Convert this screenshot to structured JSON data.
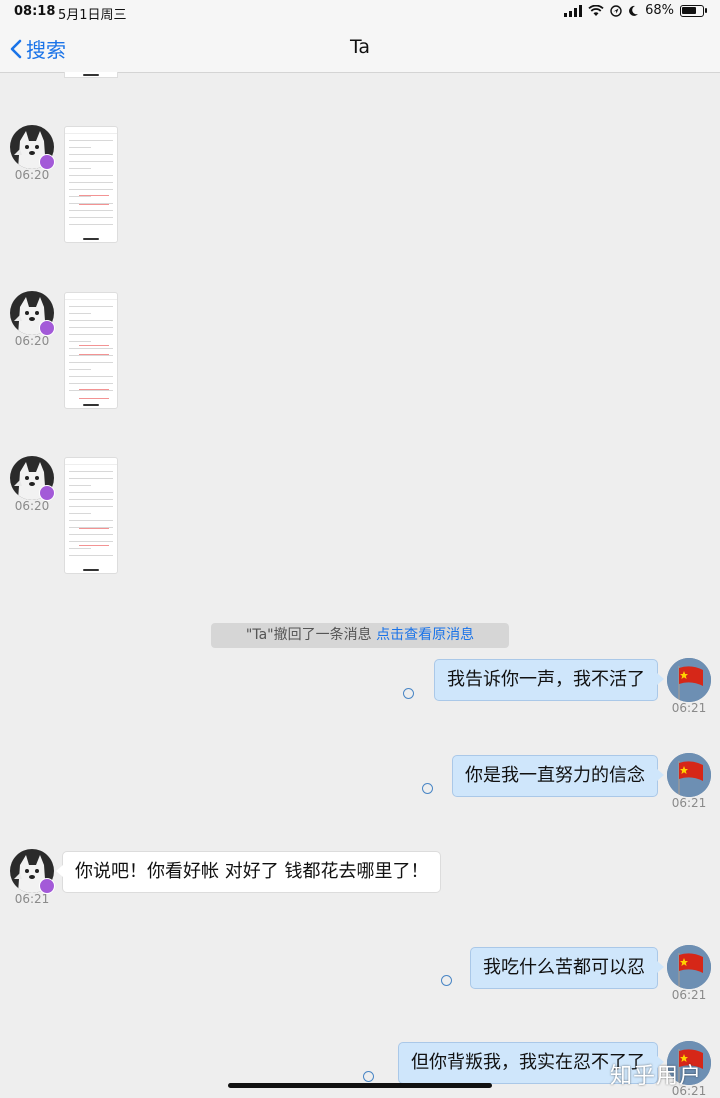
{
  "status_bar": {
    "time": "08:18",
    "date": "5月1日周三",
    "battery": "68%",
    "battery_level": 0.68,
    "icons": [
      "signal-icon",
      "wifi-icon",
      "location-icon",
      "moon-icon",
      "battery-icon"
    ]
  },
  "nav": {
    "back_label": "搜索",
    "title": "Ta"
  },
  "messages": [
    {
      "sender": "other",
      "type": "image",
      "time": "06:20"
    },
    {
      "sender": "other",
      "type": "image",
      "time": "06:20"
    },
    {
      "sender": "other",
      "type": "image",
      "time": "06:20"
    }
  ],
  "recall": {
    "text": "\"Ta\"撤回了一条消息",
    "link": "点击查看原消息"
  },
  "chat": {
    "m1": {
      "text": "我告诉你一声，我不活了",
      "time": "06:21"
    },
    "m2": {
      "text": "你是我一直努力的信念",
      "time": "06:21"
    },
    "m3": {
      "text": "你说吧！你看好帐 对好了 钱都花去哪里了！",
      "time": "06:21"
    },
    "m4": {
      "text": "我吃什么苦都可以忍",
      "time": "06:21"
    },
    "m5": {
      "text": "但你背叛我，我实在忍不了了",
      "time": "06:21"
    }
  },
  "watermark": "知乎用户",
  "colors": {
    "accent": "#1a73e8",
    "my_bubble": "#cfe6fb",
    "other_bubble": "#ffffff",
    "background": "#eeeeee",
    "badge": "#a35ad8"
  }
}
